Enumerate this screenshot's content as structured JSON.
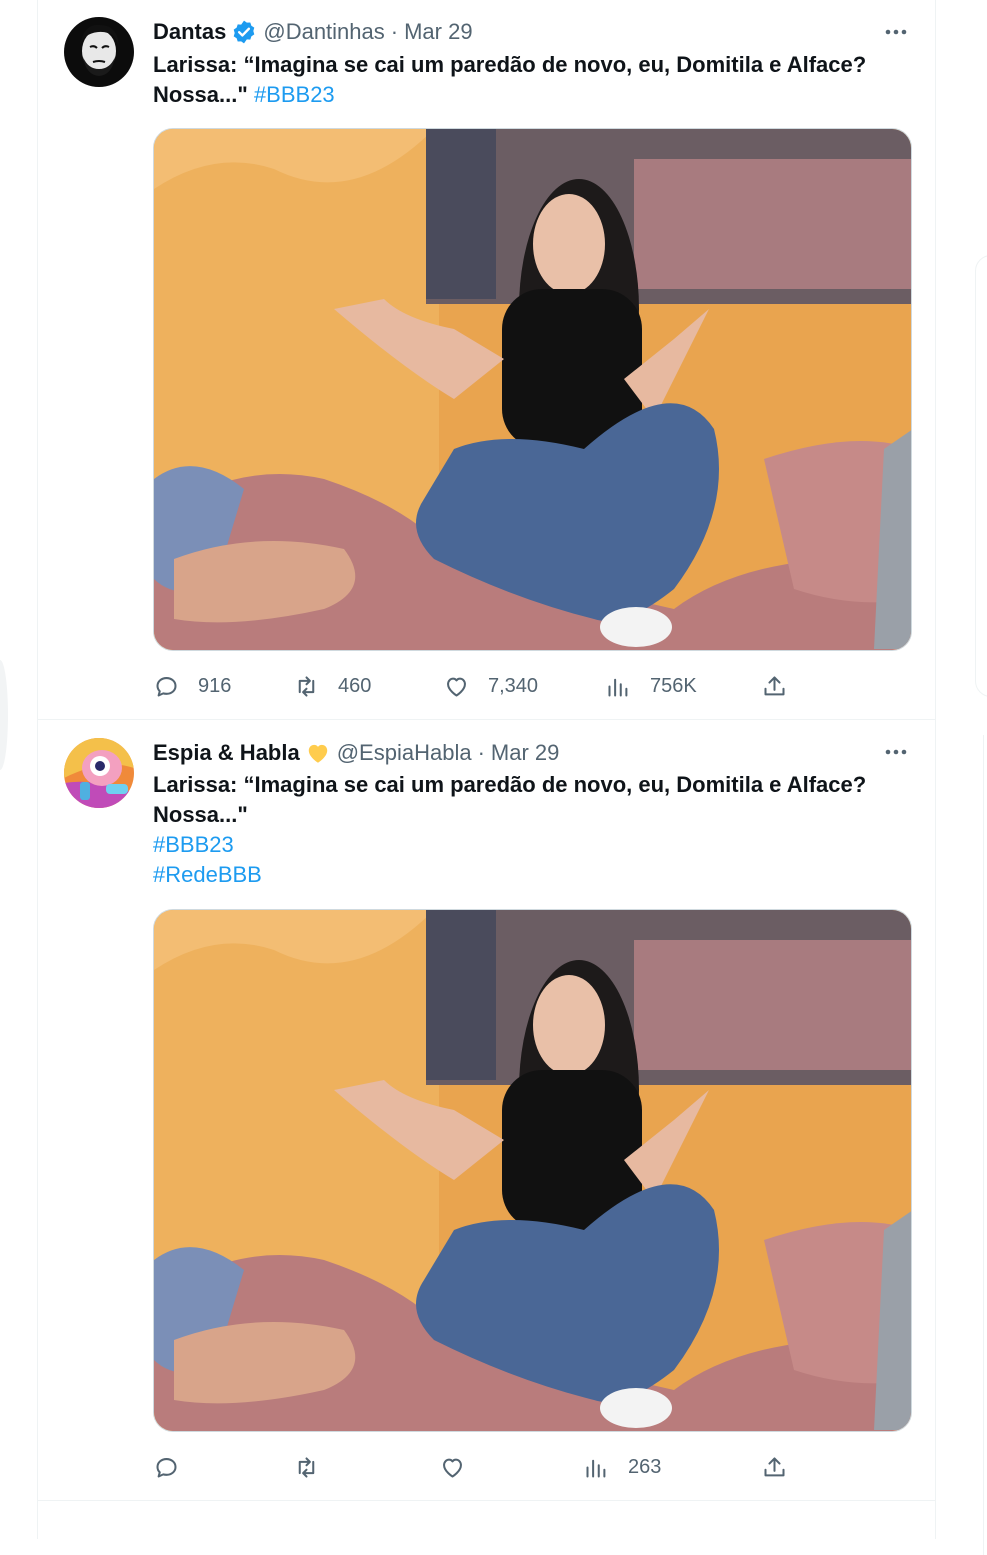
{
  "tweets": [
    {
      "display_name": "Dantas",
      "verified": "blue-check-badge",
      "handle": "@Dantinhas",
      "separator": "·",
      "date": "Mar 29",
      "text_main": "Larissa: “Imagina se cai um paredão de novo, eu, Domitila e Alface? Nossa...\"",
      "hashtags": [
        "#BBB23"
      ],
      "stats": {
        "replies": "916",
        "reposts": "460",
        "likes": "7,340",
        "views": "756K"
      }
    },
    {
      "display_name": "Espia & Habla",
      "badge": "yellow-heart-emoji",
      "handle": "@EspiaHabla",
      "separator": "·",
      "date": "Mar 29",
      "text_main": "Larissa: “Imagina se cai um paredão de novo, eu, Domitila e Alface? Nossa...\"",
      "hashtags": [
        "#BBB23",
        "#RedeBBB"
      ],
      "stats": {
        "replies": "",
        "reposts": "",
        "likes": "",
        "views": "263"
      }
    }
  ],
  "colors": {
    "accent": "#1d9bf0",
    "muted": "#536471",
    "text": "#0f1419",
    "border": "#eff3f4"
  }
}
